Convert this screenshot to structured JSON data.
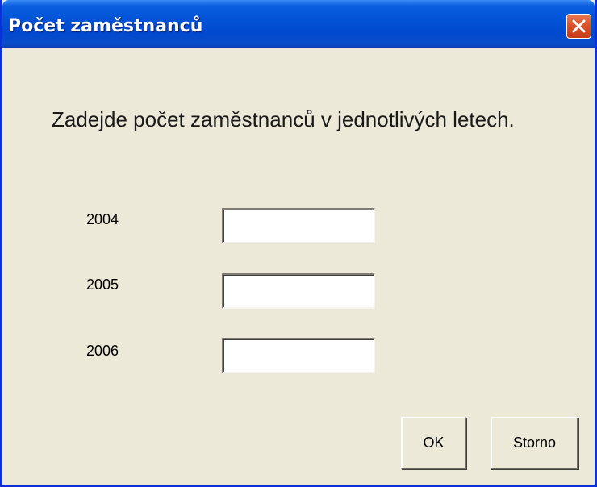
{
  "dialog": {
    "title": "Počet zaměstnanců",
    "prompt": "Zadejde počet zaměstnanců v jednotlivých letech.",
    "fields": [
      {
        "label": "2004",
        "value": ""
      },
      {
        "label": "2005",
        "value": ""
      },
      {
        "label": "2006",
        "value": ""
      }
    ],
    "ok_label": "OK",
    "cancel_label": "Storno"
  },
  "colors": {
    "titlebar": "#0353d6",
    "face": "#ece9d8",
    "close": "#d9532c"
  },
  "icons": {
    "close": "close-icon"
  }
}
